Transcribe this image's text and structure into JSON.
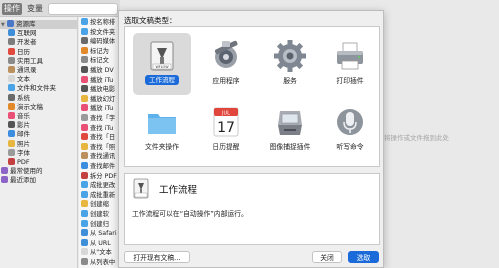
{
  "toolbar": {
    "seg_actions": "操作",
    "seg_variables": "变量"
  },
  "library": {
    "items": [
      {
        "label": "资源库",
        "color": "#4a78c8",
        "header": true,
        "tri": "▼",
        "indent": 1
      },
      {
        "label": "互联网",
        "color": "#3f8ed8",
        "indent": 8
      },
      {
        "label": "开发者",
        "color": "#7d7d7d",
        "indent": 8
      },
      {
        "label": "日历",
        "color": "#e0493e",
        "indent": 8
      },
      {
        "label": "实用工具",
        "color": "#8a8a8a",
        "indent": 8
      },
      {
        "label": "通讯录",
        "color": "#b9905e",
        "indent": 8
      },
      {
        "label": "文本",
        "color": "#d7d7d7",
        "indent": 8
      },
      {
        "label": "文件和文件夹",
        "color": "#4aa3e6",
        "indent": 8
      },
      {
        "label": "系统",
        "color": "#6a6a6a",
        "indent": 8
      },
      {
        "label": "演示文稿",
        "color": "#e28a2a",
        "indent": 8
      },
      {
        "label": "音乐",
        "color": "#ea4f75",
        "indent": 8
      },
      {
        "label": "影片",
        "color": "#555555",
        "indent": 8
      },
      {
        "label": "邮件",
        "color": "#3b8de0",
        "indent": 8
      },
      {
        "label": "照片",
        "color": "#e7b63f",
        "indent": 8
      },
      {
        "label": "字体",
        "color": "#9a9a9a",
        "indent": 8
      },
      {
        "label": "PDF",
        "color": "#c44040",
        "indent": 8
      },
      {
        "label": "最常使用的",
        "color": "#8e63c8",
        "indent": 1
      },
      {
        "label": "最近添加",
        "color": "#8e63c8",
        "indent": 1
      }
    ]
  },
  "action_list": {
    "items": [
      {
        "label": "按名称排",
        "color": "#4aa3e6"
      },
      {
        "label": "按文件夹",
        "color": "#4aa3e6"
      },
      {
        "label": "编码媒体",
        "color": "#6a6a6a"
      },
      {
        "label": "标记为",
        "color": "#e28a2a"
      },
      {
        "label": "标记文",
        "color": "#8a8a8a"
      },
      {
        "label": "播放 DV",
        "color": "#555555"
      },
      {
        "label": "播放 iTu",
        "color": "#ea4f75"
      },
      {
        "label": "播放电影",
        "color": "#555555"
      },
      {
        "label": "播放幻灯",
        "color": "#e7b63f"
      },
      {
        "label": "播放 iTu",
        "color": "#ea4f75"
      },
      {
        "label": "查找「字",
        "color": "#9a9a9a"
      },
      {
        "label": "查找 iTu",
        "color": "#ea4f75"
      },
      {
        "label": "查找「日",
        "color": "#e0493e"
      },
      {
        "label": "查找「照",
        "color": "#e7b63f"
      },
      {
        "label": "查找通讯",
        "color": "#b9905e"
      },
      {
        "label": "查找邮件",
        "color": "#3b8de0"
      },
      {
        "label": "拆分 PDF",
        "color": "#c44040"
      },
      {
        "label": "成批更改",
        "color": "#4aa3e6"
      },
      {
        "label": "成批重新",
        "color": "#4aa3e6"
      },
      {
        "label": "创建缩",
        "color": "#e7b63f"
      },
      {
        "label": "创建软",
        "color": "#4aa3e6"
      },
      {
        "label": "创建归",
        "color": "#4aa3e6"
      },
      {
        "label": "从 Safari",
        "color": "#3f8ed8"
      },
      {
        "label": "从 URL",
        "color": "#3f8ed8"
      },
      {
        "label": "从\"文本",
        "color": "#d7d7d7"
      },
      {
        "label": "从列表中",
        "color": "#8a8a8a"
      }
    ]
  },
  "dialog": {
    "title": "选取文稿类型：",
    "types": [
      {
        "label": "工作流程",
        "icon": "workflow-icon",
        "selected": true
      },
      {
        "label": "应用程序",
        "icon": "robot-application-icon",
        "selected": false
      },
      {
        "label": "服务",
        "icon": "gear-service-icon",
        "selected": false
      },
      {
        "label": "打印插件",
        "icon": "printer-icon",
        "selected": false
      },
      {
        "label": "文件夹操作",
        "icon": "folder-icon",
        "selected": false
      },
      {
        "label": "日历提醒",
        "icon": "calendar-icon",
        "selected": false
      },
      {
        "label": "图像捕捉插件",
        "icon": "scanner-icon",
        "selected": false
      },
      {
        "label": "听写命令",
        "icon": "microphone-icon",
        "selected": false
      }
    ],
    "calendar_month": "JUL",
    "calendar_day": "17",
    "workflow_badge": "WFLOW",
    "detail": {
      "title": "工作流程",
      "description": "工作流程可以在“自动操作”内部运行。"
    },
    "buttons": {
      "open_existing": "打开现有文稿...",
      "close": "关闭",
      "choose": "选取"
    }
  },
  "canvas": {
    "hint": "将操作或文件拖到此处"
  },
  "colors": {
    "accent": "#1a6bd9"
  }
}
